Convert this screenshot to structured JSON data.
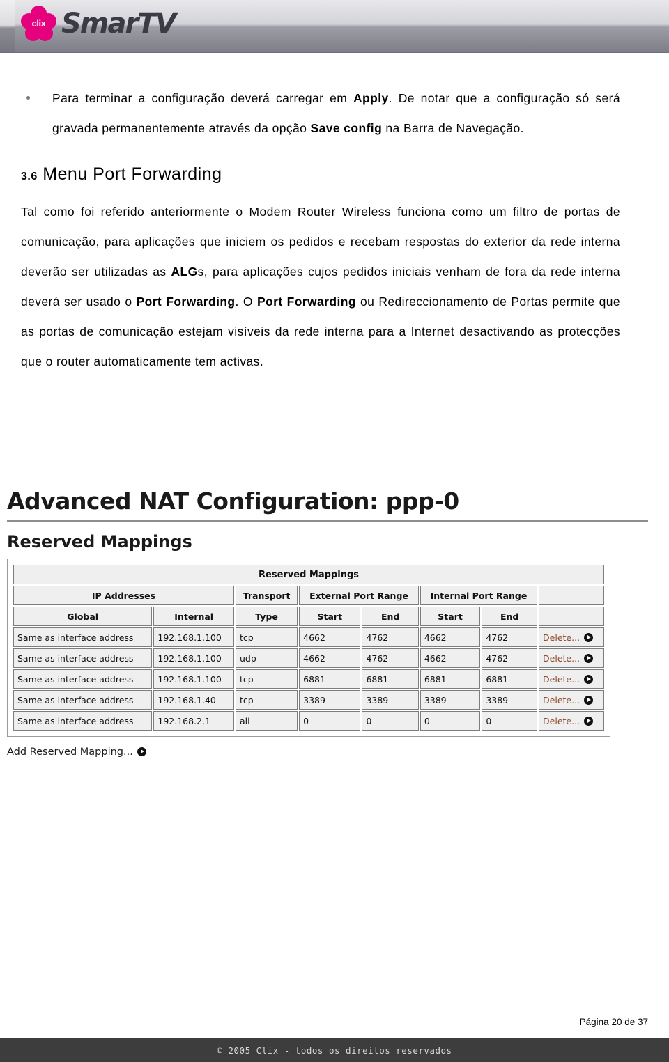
{
  "header": {
    "logo_word_clix": "clix",
    "logo_brand": "SmarTV",
    "logo_icon": "flower-logo"
  },
  "bullet": {
    "marker": "bullet-dot",
    "line1_pre": "Para terminar a configuração deverá carregar em ",
    "line1_bold": "Apply",
    "line1_post": ". De notar que a",
    "line2_pre": "configuração só será gravada permanentemente através da opção ",
    "line2_bold": "Save config",
    "line3": "na Barra de Navegação."
  },
  "section": {
    "number": "3.",
    "number_sub": "6",
    "title": "Menu Port Forwarding"
  },
  "body": {
    "p1_a": "Tal como foi referido anteriormente o Modem Router Wireless funciona como um",
    "p1_b": "filtro de portas de comunicação, para aplicações que iniciem os pedidos e recebam",
    "p1_c_pre": "respostas do exterior da rede interna deverão ser utilizadas as ",
    "p1_c_bold": "ALG",
    "p1_c_post": "s, para",
    "p1_d": "aplicações cujos pedidos iniciais venham de fora da rede interna deverá ser usado",
    "p1_e_pre": "o ",
    "p1_e_bold1": "Port Forwarding",
    "p1_e_mid": ". O ",
    "p1_e_bold2": "Port Forwarding",
    "p1_e_post": " ou Redireccionamento de Portas permite",
    "p1_f": "que as portas de comunicação estejam visíveis da rede interna para a Internet",
    "p1_g": "desactivando as protecções que o router automaticamente tem activas."
  },
  "screenshot": {
    "title": "Advanced NAT Configuration: ppp-0",
    "subtitle": "Reserved Mappings",
    "table_title": "Reserved Mappings",
    "group_headers": {
      "ip_addresses": "IP Addresses",
      "transport": "Transport",
      "external_port_range": "External Port Range",
      "internal_port_range": "Internal Port Range",
      "action": ""
    },
    "sub_headers": [
      "Global",
      "Internal",
      "Type",
      "Start",
      "End",
      "Start",
      "End",
      ""
    ],
    "rows": [
      {
        "global": "Same as interface address",
        "internal": "192.168.1.100",
        "type": "tcp",
        "ext_start": "4662",
        "ext_end": "4762",
        "int_start": "4662",
        "int_end": "4762",
        "action": "Delete..."
      },
      {
        "global": "Same as interface address",
        "internal": "192.168.1.100",
        "type": "udp",
        "ext_start": "4662",
        "ext_end": "4762",
        "int_start": "4662",
        "int_end": "4762",
        "action": "Delete..."
      },
      {
        "global": "Same as interface address",
        "internal": "192.168.1.100",
        "type": "tcp",
        "ext_start": "6881",
        "ext_end": "6881",
        "int_start": "6881",
        "int_end": "6881",
        "action": "Delete..."
      },
      {
        "global": "Same as interface address",
        "internal": "192.168.1.40",
        "type": "tcp",
        "ext_start": "3389",
        "ext_end": "3389",
        "int_start": "3389",
        "int_end": "3389",
        "action": "Delete..."
      },
      {
        "global": "Same as interface address",
        "internal": "192.168.2.1",
        "type": "all",
        "ext_start": "0",
        "ext_end": "0",
        "int_start": "0",
        "int_end": "0",
        "action": "Delete..."
      }
    ],
    "add_link": "Add Reserved Mapping..."
  },
  "footer": {
    "page_label": "Página 20 de 37",
    "copyright": "© 2005 Clix - todos os direitos reservados"
  }
}
